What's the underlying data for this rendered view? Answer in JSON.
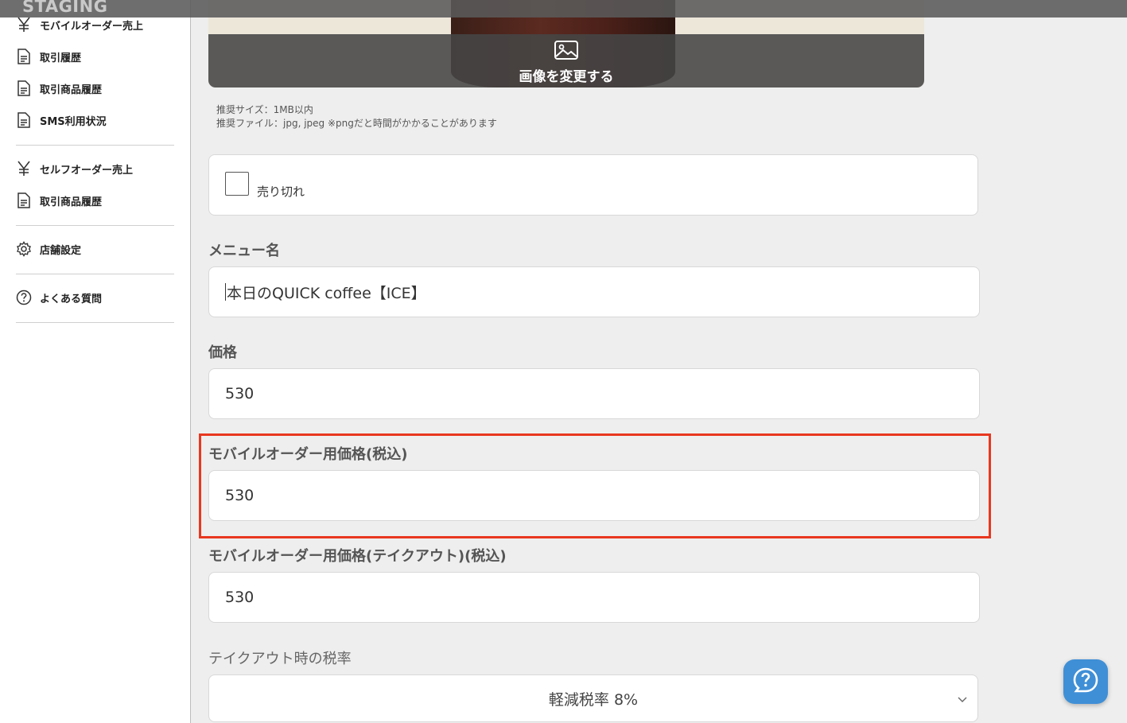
{
  "banner": {
    "text": "STAGING"
  },
  "sidebar": {
    "items": [
      {
        "label": "モバイルオーダー売上",
        "icon": "yen-icon"
      },
      {
        "label": "取引履歴",
        "icon": "document-icon"
      },
      {
        "label": "取引商品履歴",
        "icon": "document-icon"
      },
      {
        "label": "SMS利用状況",
        "icon": "document-icon"
      },
      {
        "label": "セルフオーダー売上",
        "icon": "yen-icon"
      },
      {
        "label": "取引商品履歴",
        "icon": "document-icon"
      },
      {
        "label": "店舗設定",
        "icon": "gear-icon"
      },
      {
        "label": "よくある質問",
        "icon": "question-circle-icon"
      }
    ]
  },
  "image": {
    "change_label": "画像を変更する",
    "hint_size": "推奨サイズ：1MB以内",
    "hint_file": "推奨ファイル：jpg, jpeg ※pngだと時間がかかることがあります"
  },
  "soldout": {
    "label": "売り切れ",
    "checked": false
  },
  "fields": {
    "menu_name": {
      "label": "メニュー名",
      "value": "本日のQUICK coffee【ICE】"
    },
    "price": {
      "label": "価格",
      "value": "530"
    },
    "mobile_price": {
      "label": "モバイルオーダー用価格(税込)",
      "value": "530"
    },
    "mobile_takeout_price": {
      "label": "モバイルオーダー用価格(テイクアウト)(税込)",
      "value": "530"
    },
    "takeout_tax": {
      "label": "テイクアウト時の税率",
      "value": "軽減税率 8%"
    }
  },
  "colors": {
    "highlight": "#e8371f",
    "help_button": "#3f8fd6"
  }
}
